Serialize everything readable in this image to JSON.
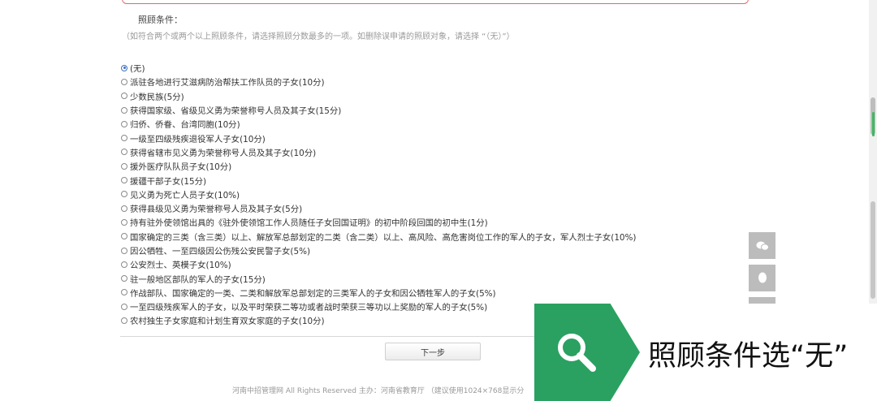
{
  "form": {
    "title": "照顾条件：",
    "note": "（如符合两个或两个以上照顾条件，请选择照顾分数最多的一项。如删除误申请的照顾对象，请选择 “（无）”）",
    "options": [
      {
        "label": "(无)",
        "checked": true
      },
      {
        "label": "派驻各地进行艾滋病防治帮扶工作队员的子女(10分)",
        "checked": false
      },
      {
        "label": "少数民族(5分)",
        "checked": false
      },
      {
        "label": "获得国家级、省级见义勇为荣誉称号人员及其子女(15分)",
        "checked": false
      },
      {
        "label": "归侨、侨眷、台湾同胞(10分)",
        "checked": false
      },
      {
        "label": "一级至四级残疾退役军人子女(10分)",
        "checked": false
      },
      {
        "label": "获得省辖市见义勇为荣誉称号人员及其子女(10分)",
        "checked": false
      },
      {
        "label": "援外医疗队队员子女(10分)",
        "checked": false
      },
      {
        "label": "援疆干部子女(15分)",
        "checked": false
      },
      {
        "label": "见义勇为死亡人员子女(10%)",
        "checked": false
      },
      {
        "label": "获得县级见义勇为荣誉称号人员及其子女(5分)",
        "checked": false
      },
      {
        "label": "持有驻外使领馆出具的《驻外使领馆工作人员随任子女回国证明》的初中阶段回国的初中生(1分)",
        "checked": false
      },
      {
        "label": "国家确定的三类（含三类）以上、解放军总部划定的二类（含二类）以上、高风险、高危害岗位工作的军人的子女，军人烈士子女(10%)",
        "checked": false
      },
      {
        "label": "因公牺牲、一至四级因公伤残公安民警子女(5%)",
        "checked": false
      },
      {
        "label": "公安烈士、英模子女(10%)",
        "checked": false
      },
      {
        "label": "驻一般地区部队的军人的子女(15分)",
        "checked": false
      },
      {
        "label": "作战部队、国家确定的一类、二类和解放军总部划定的三类军人的子女和因公牺牲军人的子女(5%)",
        "checked": false
      },
      {
        "label": "一至四级残疾军人的子女，以及平时荣获二等功或者战时荣获三等功以上奖励的军人的子女(5%)",
        "checked": false
      },
      {
        "label": "农村独生子女家庭和计划生育双女家庭的子女(10分)",
        "checked": false
      }
    ],
    "next_label": "下一步"
  },
  "footer": "河南中招管理网 All Rights Reserved 主办：河南省教育厅 （建议使用1024×768显示分",
  "side_buttons": [
    "chat-icon",
    "qq-icon",
    "top-icon"
  ],
  "banner": {
    "text": "照顾条件选“无”",
    "icon": "search-icon",
    "accent": "#2aa160"
  }
}
